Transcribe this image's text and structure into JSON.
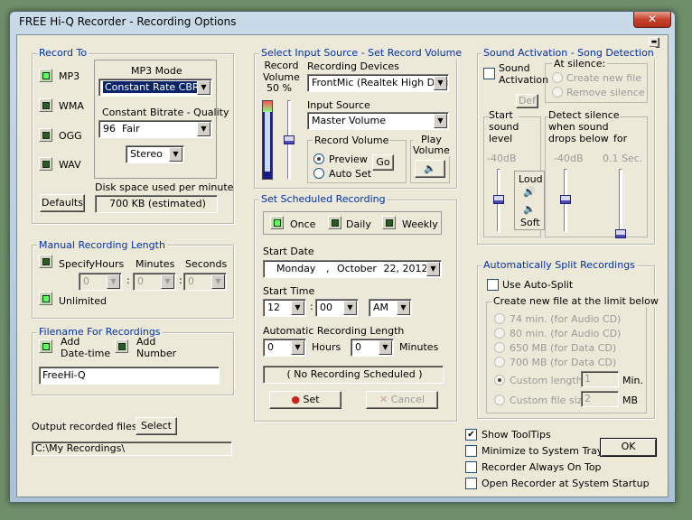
{
  "window": {
    "title": "FREE Hi-Q Recorder - Recording Options",
    "close": "✕",
    "minimize": "▬"
  },
  "record_to": {
    "legend": "Record To",
    "formats": [
      "MP3",
      "WMA",
      "OGG",
      "WAV"
    ],
    "active_format": "MP3",
    "mp3_mode_label": "MP3 Mode",
    "mp3_mode": "Constant Rate CBR",
    "bitrate_label": "Constant Bitrate - Quality",
    "bitrate": "96  Fair",
    "channels": "Stereo",
    "defaults": "Defaults",
    "disk_label": "Disk space used per minute",
    "disk_value": "700  KB (estimated)"
  },
  "manual": {
    "legend": "Manual Recording Length",
    "specify": "Specify",
    "hours_label": "Hours",
    "minutes_label": "Minutes",
    "seconds_label": "Seconds",
    "hours": "0",
    "minutes": "0",
    "seconds": "0",
    "unlimited": "Unlimited"
  },
  "filename": {
    "legend": "Filename For Recordings",
    "add_datetime": "Add\nDate-time",
    "add_number": "Add\nNumber",
    "value": "FreeHi-Q"
  },
  "output": {
    "label": "Output recorded files to",
    "select": "Select",
    "path": "C:\\My Recordings\\"
  },
  "input": {
    "legend": "Select Input Source - Set Record Volume",
    "record_volume_label": "Record\nVolume",
    "volume_percent": "50 %",
    "volume_level": 0.5,
    "devices_label": "Recording Devices",
    "device": "FrontMic (Realtek High Defir",
    "source_label": "Input Source",
    "source": "Master Volume",
    "rec_vol_group": "Record Volume",
    "preview": "Preview",
    "auto_set": "Auto Set",
    "go": "Go",
    "play_volume": "Play\nVolume"
  },
  "schedule": {
    "legend": "Set Scheduled Recording",
    "once": "Once",
    "daily": "Daily",
    "weekly": "Weekly",
    "start_date_label": "Start Date",
    "date_day": "Monday",
    "date_sep": ",",
    "date_month": "October",
    "date_rest": "22, 2012",
    "start_time_label": "Start Time",
    "hour": "12",
    "minute": "00",
    "ampm": "AM",
    "length_label": "Automatic Recording Length",
    "len_hours": "0",
    "len_hours_label": "Hours",
    "len_minutes": "0",
    "len_minutes_label": "Minutes",
    "status": "( No Recording Scheduled )",
    "set": "Set",
    "cancel": "Cancel"
  },
  "sound": {
    "legend": "Sound Activation - Song Detection",
    "sound_activation": "Sound\nActivation",
    "at_silence": "At silence:",
    "create_new_file": "Create new file",
    "remove_silence": "Remove silence",
    "def": "Def",
    "start_group": "Start\nsound\nlevel",
    "start_level": "-40dB",
    "detect_group": "Detect silence\nwhen sound\ndrops below",
    "for_label": "for",
    "detect_level": "-40dB",
    "detect_secs": "0.1  Sec.",
    "loud": "Loud",
    "soft": "Soft"
  },
  "split": {
    "legend": "Automatically Split Recordings",
    "use": "Use Auto-Split",
    "create_group": "Create new file at the limit below",
    "options": [
      "74 min. (for Audio CD)",
      "80 min. (for Audio CD)",
      "650 MB (for Data CD)",
      "700 MB (for Data CD)"
    ],
    "custom_length": "Custom length",
    "custom_length_val": "1",
    "min": "Min.",
    "custom_size": "Custom file size",
    "custom_size_val": "2",
    "mb": "MB"
  },
  "options": {
    "show_tooltips": "Show ToolTips",
    "minimize_tray": "Minimize to System Tray",
    "always_on_top": "Recorder Always On Top",
    "startup": "Open Recorder at System Startup",
    "ok": "OK"
  }
}
